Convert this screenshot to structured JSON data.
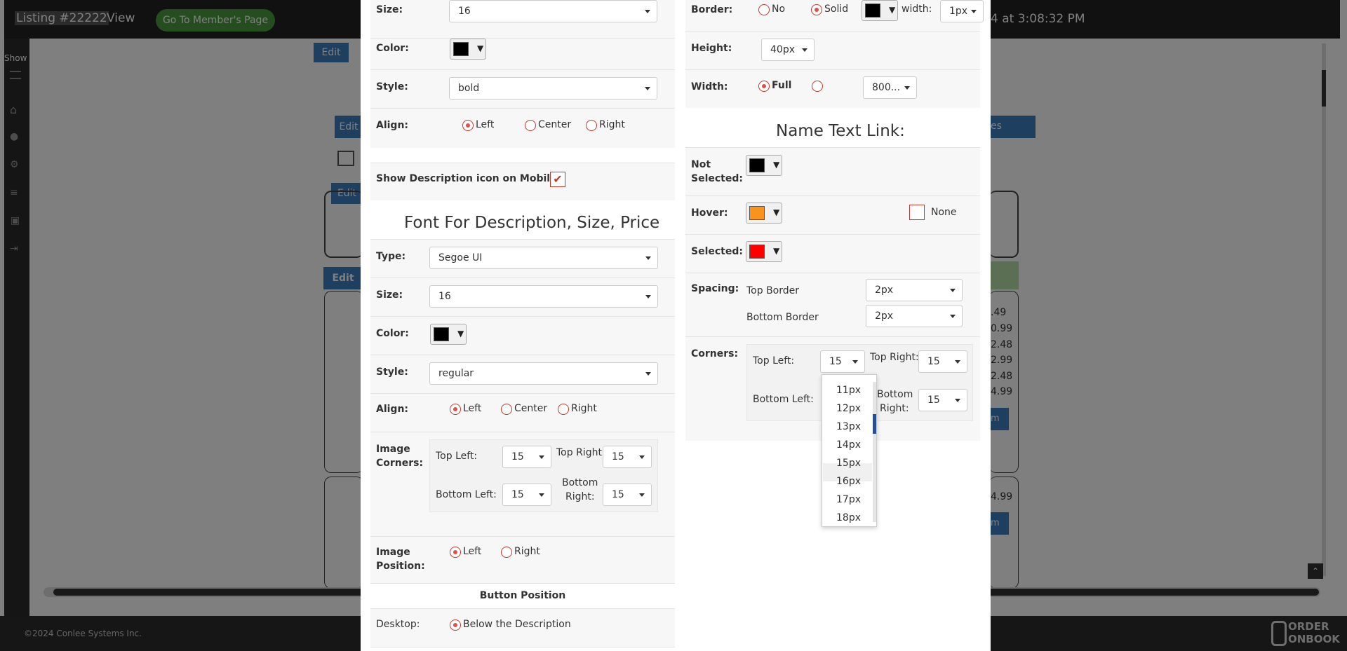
{
  "header": {
    "listing": "Listing #22222",
    "view": "View",
    "member_button": "Go To Member's Page",
    "timestamp": "4 at 3:08:32 PM"
  },
  "background": {
    "show_label": "Show",
    "edit_label": "Edit",
    "prices": [
      ".49",
      "0.99",
      "2.48",
      "2.99",
      "2.48",
      "4.99",
      "4.99"
    ],
    "cut_label_es": "es",
    "cut_label_m": "m",
    "footer_copyright": "©2024 Conlee Systems Inc.",
    "logo_text_1": "ORDER",
    "logo_text_2": "ONBOOK"
  },
  "left": {
    "size_label": "Size:",
    "size_value": "16",
    "color_label": "Color:",
    "style_label": "Style:",
    "style_value": "bold",
    "align_label": "Align:",
    "align_left": "Left",
    "align_center": "Center",
    "align_right": "Right",
    "show_desc_icon_label": "Show Description icon on Mobile:",
    "font_desc_heading": "Font For Description, Size, Price",
    "type_label": "Type:",
    "type_value": "Segoe UI",
    "size2_label": "Size:",
    "size2_value": "16",
    "color2_label": "Color:",
    "style2_label": "Style:",
    "style2_value": "regular",
    "align2_label": "Align:",
    "align2_left": "Left",
    "align2_center": "Center",
    "align2_right": "Right",
    "image_corners_label_1": "Image",
    "image_corners_label_2": "Corners:",
    "top_left_label": "Top Left:",
    "top_left_value": "15",
    "top_right_label": "Top Right:",
    "top_right_value": "15",
    "bottom_left_label": "Bottom Left:",
    "bottom_left_value": "15",
    "bottom_right_label_1": "Bottom",
    "bottom_right_label_2": "Right:",
    "bottom_right_value": "15",
    "image_position_label_1": "Image",
    "image_position_label_2": "Position:",
    "image_pos_left": "Left",
    "image_pos_right": "Right",
    "button_position_heading": "Button Position",
    "desktop_label": "Desktop:",
    "desktop_option": "Below the Description"
  },
  "right": {
    "border_label": "Border:",
    "border_no": "No",
    "border_solid": "Solid",
    "width_label": "width:",
    "border_width_value": "1px",
    "height_label": "Height:",
    "height_value": "40px",
    "width2_label": "Width:",
    "width_full": "Full",
    "width_value": "800...",
    "name_text_link_heading": "Name Text Link:",
    "not_selected_label_1": "Not",
    "not_selected_label_2": "Selected:",
    "hover_label": "Hover:",
    "none_label": "None",
    "selected_label": "Selected:",
    "spacing_label": "Spacing:",
    "top_border_label": "Top Border",
    "top_border_value": "2px",
    "bottom_border_label": "Bottom Border",
    "bottom_border_value": "2px",
    "corners_label": "Corners:",
    "top_left_label": "Top Left:",
    "top_left_value": "15",
    "top_right_label": "Top Right:",
    "top_right_value": "15",
    "bottom_left_label": "Bottom Left:",
    "bottom_right_label_1": "Bottom",
    "bottom_right_label_2": "Right:",
    "bottom_right_value": "15"
  },
  "dropdown": {
    "options": [
      "11px",
      "12px",
      "13px",
      "14px",
      "15px",
      "16px",
      "17px",
      "18px"
    ],
    "highlighted": "15px"
  },
  "colors": {
    "black": "#000000",
    "orange": "#f7931e",
    "red": "#ff0000",
    "accent_radio": "#d9534f",
    "member_button": "#4a9a3f",
    "edit_blue": "#3f7fc1"
  }
}
